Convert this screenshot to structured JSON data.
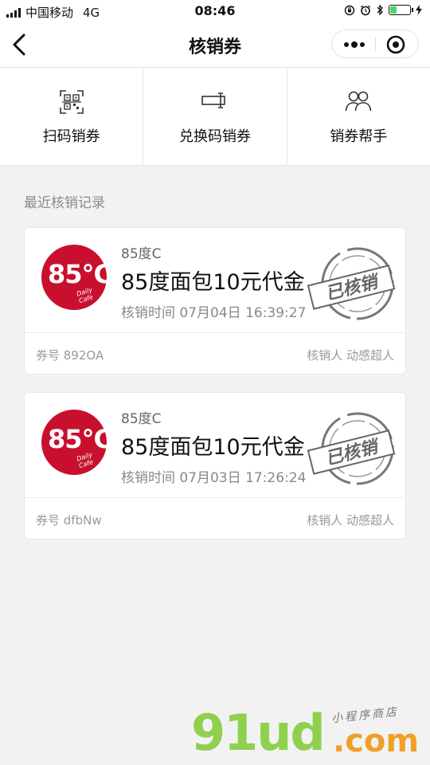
{
  "status_bar": {
    "carrier": "中国移动",
    "network": "4G",
    "time": "08:46",
    "icons": [
      "lock-rotation-icon",
      "alarm-icon",
      "bluetooth-icon",
      "battery-icon",
      "charging-icon"
    ],
    "battery_level": 0.3
  },
  "nav": {
    "title": "核销券",
    "back_icon": "chevron-left-icon",
    "more_icon": "more-dots-icon",
    "close_icon": "target-icon"
  },
  "actions": [
    {
      "label": "扫码销券",
      "icon": "qr-scan-icon"
    },
    {
      "label": "兑换码销券",
      "icon": "code-input-icon"
    },
    {
      "label": "销券帮手",
      "icon": "users-icon"
    }
  ],
  "section_title": "最近核销记录",
  "records": [
    {
      "brand": "85度C",
      "logo_text": "85°C",
      "logo_script": "Daily Cafe",
      "title": "85度面包10元代金",
      "time": "核销时间 07月04日 16:39:27",
      "code": "券号 892OA",
      "operator": "核销人 动感超人",
      "stamp": "已核销"
    },
    {
      "brand": "85度C",
      "logo_text": "85°C",
      "logo_script": "Daily Cafe",
      "title": "85度面包10元代金",
      "time": "核销时间 07月03日 17:26:24",
      "code": "券号 dfbNw",
      "operator": "核销人 动感超人",
      "stamp": "已核销"
    }
  ],
  "watermark": {
    "main": "91ud",
    "suffix": ".com",
    "tagline": "小程序商店"
  },
  "colors": {
    "brand_red": "#c8102e",
    "battery_green": "#4cd964",
    "watermark_green": "#8fd14f",
    "watermark_orange": "#f0a028"
  }
}
